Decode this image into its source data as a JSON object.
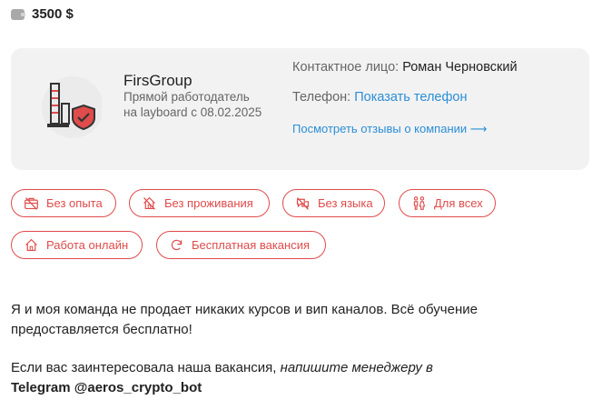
{
  "salary": {
    "amount": "3500 $"
  },
  "company": {
    "name": "FirsGroup",
    "subtitle_line1": "Прямой работодатель",
    "subtitle_line2": "на layboard с 08.02.2025",
    "contact_label": "Контактное лицо:",
    "contact_name": "Роман Черновский",
    "phone_label": "Телефон:",
    "phone_link": "Показать телефон",
    "reviews_link": "Посмотреть отзывы о компании ⟶"
  },
  "tags": [
    {
      "label": "Без опыта",
      "icon": "briefcase-icon"
    },
    {
      "label": "Без проживания",
      "icon": "home-crossed-icon"
    },
    {
      "label": "Без языка",
      "icon": "speech-crossed-icon"
    },
    {
      "label": "Для всех",
      "icon": "people-icon"
    },
    {
      "label": "Работа онлайн",
      "icon": "home-icon"
    },
    {
      "label": "Бесплатная вакансия",
      "icon": "refresh-icon"
    }
  ],
  "description": {
    "paragraph1": "Я и моя команда не  продает никаких курсов и вип каналов. Всё обучение предоставляется бесплатно!",
    "paragraph2_plain": "Если вас заинтересовала наша вакансия, ",
    "paragraph2_italic": "напишите менеджеру в",
    "paragraph2_bold": "Telegram @aeros_crypto_bot"
  },
  "colors": {
    "accent": "#e04b4b",
    "link": "#2b8fd6",
    "card_bg": "#f2f2f2"
  }
}
